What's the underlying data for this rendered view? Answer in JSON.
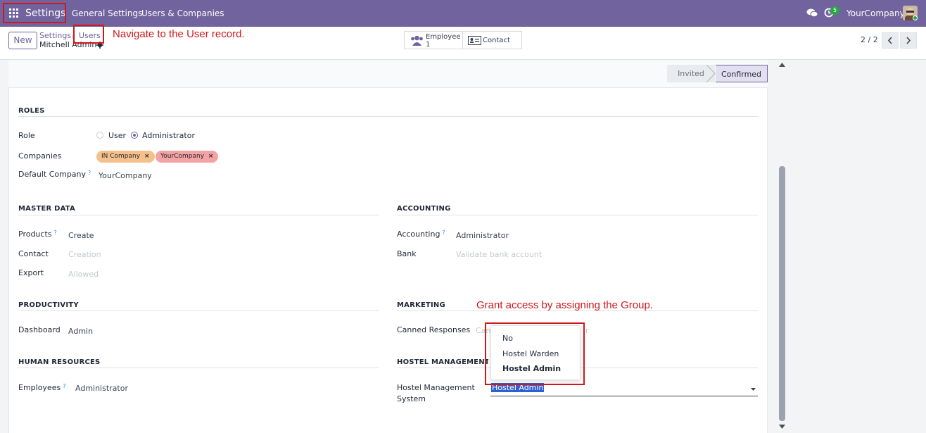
{
  "navbar": {
    "app_title": "Settings",
    "menu": [
      "General Settings",
      "Users & Companies"
    ],
    "messages_icon": "chat-icon",
    "activity_icon": "clock-icon",
    "activity_count": "5",
    "company": "YourCompany"
  },
  "control": {
    "new_label": "New",
    "breadcrumb_parent": "Settings",
    "breadcrumb_current": "Users",
    "record_name": "Mitchell Admin",
    "smart_employee_label": "Employee",
    "smart_employee_count": "1",
    "smart_contact_label": "Contact",
    "pager": "2 / 2"
  },
  "status": {
    "inactive": "Invited",
    "active": "Confirmed"
  },
  "roles": {
    "title": "ROLES",
    "role_label": "Role",
    "role_options": [
      "User",
      "Administrator"
    ],
    "role_selected": "Administrator",
    "companies_label": "Companies",
    "companies": [
      "IN Company",
      "YourCompany"
    ],
    "default_company_label": "Default Company",
    "default_company_value": "YourCompany"
  },
  "master_data": {
    "title": "MASTER DATA",
    "products_label": "Products",
    "products_value": "Create",
    "contact_label": "Contact",
    "contact_placeholder": "Creation",
    "export_label": "Export",
    "export_placeholder": "Allowed"
  },
  "accounting": {
    "title": "ACCOUNTING",
    "accounting_label": "Accounting",
    "accounting_value": "Administrator",
    "bank_label": "Bank",
    "bank_placeholder": "Validate bank account"
  },
  "productivity": {
    "title": "PRODUCTIVITY",
    "dashboard_label": "Dashboard",
    "dashboard_value": "Admin"
  },
  "marketing": {
    "title": "MARKETING",
    "canned_label": "Canned Responses",
    "canned_placeholder_left": "Can",
    "canned_placeholder_right": "r"
  },
  "human_resources": {
    "title": "HUMAN RESOURCES",
    "employees_label": "Employees",
    "employees_value": "Administrator"
  },
  "hostel": {
    "title": "HOSTEL MANAGEMENT SYSTEM",
    "field_label_line1": "Hostel Management",
    "field_label_line2": "System",
    "field_value": "Hostel Admin",
    "options": [
      "No",
      "Hostel Warden",
      "Hostel Admin"
    ]
  },
  "annotations": {
    "navigate": "Navigate to the User record.",
    "grant": "Grant access by assigning the Group."
  },
  "colors": {
    "brand": "#71639e",
    "annotation": "#d1171a",
    "tag_orange": "#f5c08a",
    "tag_red": "#f4a3a3"
  }
}
